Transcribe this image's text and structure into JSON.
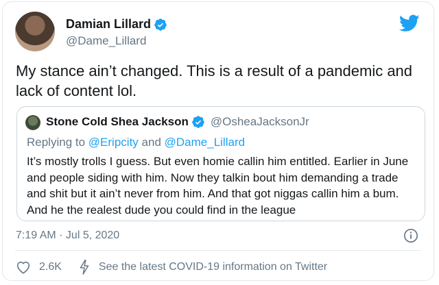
{
  "author": {
    "name": "Damian Lillard",
    "handle": "@Dame_Lillard",
    "avatar_icon": "avatar-photo",
    "verified_icon": "verified-badge-icon"
  },
  "tweet": {
    "text": "My stance ain’t changed. This is a result of a pandemic and lack of content lol."
  },
  "quoted_tweet": {
    "name": "Stone Cold Shea Jackson",
    "handle": "@OsheaJacksonJr",
    "replying_prefix": "Replying to",
    "replying_to_1": "@Eripcity",
    "replying_and": "and",
    "replying_to_2": "@Dame_Lillard",
    "text": "It’s mostly trolls I guess. But even homie callin him entitled. Earlier in June and people siding with him. Now they talkin bout him demanding a trade and shit but it ain’t never from him. And that got niggas callin him a bum. And he the realest dude you could find in the league"
  },
  "meta": {
    "timestamp": "7:19 AM · Jul 5, 2020",
    "like_count": "2.6K",
    "covid_link": "See the latest COVID-19 information on Twitter"
  },
  "colors": {
    "accent": "#1da1f2",
    "secondary_text": "#657786",
    "border": "#e1e8ed"
  },
  "icons": [
    "twitter-bird-icon",
    "verified-badge-icon",
    "info-icon",
    "heart-icon",
    "bolt-icon"
  ]
}
